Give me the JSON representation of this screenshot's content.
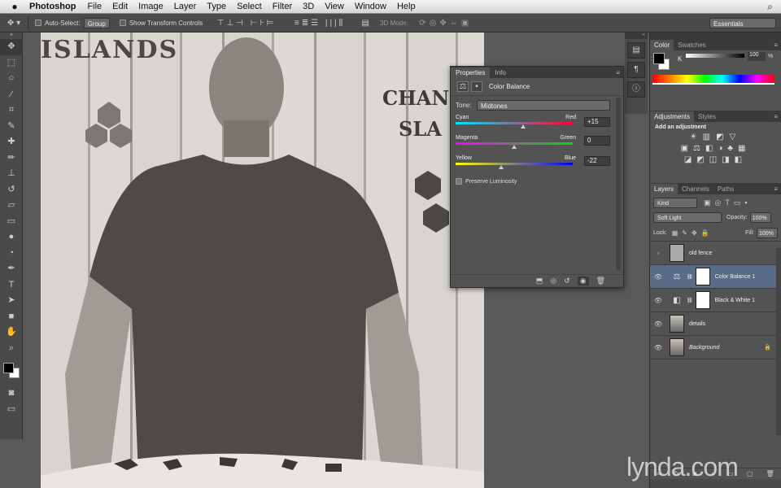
{
  "menubar": {
    "apple": "",
    "app": "Photoshop",
    "items": [
      "File",
      "Edit",
      "Image",
      "Layer",
      "Type",
      "Select",
      "Filter",
      "3D",
      "View",
      "Window",
      "Help"
    ],
    "search_icon": "magnifier-icon"
  },
  "options": {
    "auto_select": "Auto-Select:",
    "group": "Group",
    "show_transform": "Show Transform Controls",
    "mode3d": "3D Mode:",
    "workspace": "Essentials"
  },
  "properties": {
    "tabs": [
      "Properties",
      "Info"
    ],
    "title": "Color Balance",
    "tone_label": "Tone:",
    "tone_value": "Midtones",
    "sliders": [
      {
        "left": "Cyan",
        "right": "Red",
        "value": "+15",
        "pos": 0.575,
        "gradient": "linear-gradient(90deg,#00e5ff,#ff0033)"
      },
      {
        "left": "Magenta",
        "right": "Green",
        "value": "0",
        "pos": 0.5,
        "gradient": "linear-gradient(90deg,#ff00ff,#00dd00)"
      },
      {
        "left": "Yellow",
        "right": "Blue",
        "value": "-22",
        "pos": 0.39,
        "gradient": "linear-gradient(90deg,#ffff00,#0000ff)"
      }
    ],
    "preserve": "Preserve Luminosity"
  },
  "color_panel": {
    "tabs": [
      "Color",
      "Swatches"
    ],
    "channel": "K",
    "value": "100",
    "unit": "%"
  },
  "adjustments": {
    "tabs": [
      "Adjustments",
      "Styles"
    ],
    "title": "Add an adjustment"
  },
  "layers_panel": {
    "tabs": [
      "Layers",
      "Channels",
      "Paths"
    ],
    "kind": "Kind",
    "blend": "Soft Light",
    "opacity_label": "Opacity:",
    "opacity": "100%",
    "lock_label": "Lock:",
    "fill_label": "Fill:",
    "fill": "100%",
    "layers": [
      {
        "name": "old fence",
        "visible": false,
        "type": "pixel"
      },
      {
        "name": "Color Balance 1",
        "visible": true,
        "type": "adjust",
        "selected": true
      },
      {
        "name": "Black & White 1",
        "visible": true,
        "type": "adjust"
      },
      {
        "name": "details",
        "visible": true,
        "type": "photo"
      },
      {
        "name": "Background",
        "visible": true,
        "type": "photo",
        "italic": true
      }
    ]
  },
  "canvas_text": [
    "ISLANDS",
    "CHAN",
    "SLA"
  ],
  "watermark": "lynda.com"
}
